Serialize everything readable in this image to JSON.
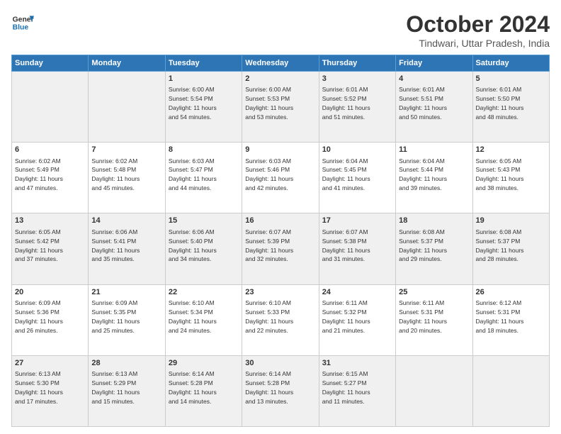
{
  "logo": {
    "line1": "General",
    "line2": "Blue"
  },
  "header": {
    "month": "October 2024",
    "location": "Tindwari, Uttar Pradesh, India"
  },
  "weekdays": [
    "Sunday",
    "Monday",
    "Tuesday",
    "Wednesday",
    "Thursday",
    "Friday",
    "Saturday"
  ],
  "weeks": [
    [
      {
        "day": "",
        "info": ""
      },
      {
        "day": "",
        "info": ""
      },
      {
        "day": "1",
        "info": "Sunrise: 6:00 AM\nSunset: 5:54 PM\nDaylight: 11 hours\nand 54 minutes."
      },
      {
        "day": "2",
        "info": "Sunrise: 6:00 AM\nSunset: 5:53 PM\nDaylight: 11 hours\nand 53 minutes."
      },
      {
        "day": "3",
        "info": "Sunrise: 6:01 AM\nSunset: 5:52 PM\nDaylight: 11 hours\nand 51 minutes."
      },
      {
        "day": "4",
        "info": "Sunrise: 6:01 AM\nSunset: 5:51 PM\nDaylight: 11 hours\nand 50 minutes."
      },
      {
        "day": "5",
        "info": "Sunrise: 6:01 AM\nSunset: 5:50 PM\nDaylight: 11 hours\nand 48 minutes."
      }
    ],
    [
      {
        "day": "6",
        "info": "Sunrise: 6:02 AM\nSunset: 5:49 PM\nDaylight: 11 hours\nand 47 minutes."
      },
      {
        "day": "7",
        "info": "Sunrise: 6:02 AM\nSunset: 5:48 PM\nDaylight: 11 hours\nand 45 minutes."
      },
      {
        "day": "8",
        "info": "Sunrise: 6:03 AM\nSunset: 5:47 PM\nDaylight: 11 hours\nand 44 minutes."
      },
      {
        "day": "9",
        "info": "Sunrise: 6:03 AM\nSunset: 5:46 PM\nDaylight: 11 hours\nand 42 minutes."
      },
      {
        "day": "10",
        "info": "Sunrise: 6:04 AM\nSunset: 5:45 PM\nDaylight: 11 hours\nand 41 minutes."
      },
      {
        "day": "11",
        "info": "Sunrise: 6:04 AM\nSunset: 5:44 PM\nDaylight: 11 hours\nand 39 minutes."
      },
      {
        "day": "12",
        "info": "Sunrise: 6:05 AM\nSunset: 5:43 PM\nDaylight: 11 hours\nand 38 minutes."
      }
    ],
    [
      {
        "day": "13",
        "info": "Sunrise: 6:05 AM\nSunset: 5:42 PM\nDaylight: 11 hours\nand 37 minutes."
      },
      {
        "day": "14",
        "info": "Sunrise: 6:06 AM\nSunset: 5:41 PM\nDaylight: 11 hours\nand 35 minutes."
      },
      {
        "day": "15",
        "info": "Sunrise: 6:06 AM\nSunset: 5:40 PM\nDaylight: 11 hours\nand 34 minutes."
      },
      {
        "day": "16",
        "info": "Sunrise: 6:07 AM\nSunset: 5:39 PM\nDaylight: 11 hours\nand 32 minutes."
      },
      {
        "day": "17",
        "info": "Sunrise: 6:07 AM\nSunset: 5:38 PM\nDaylight: 11 hours\nand 31 minutes."
      },
      {
        "day": "18",
        "info": "Sunrise: 6:08 AM\nSunset: 5:37 PM\nDaylight: 11 hours\nand 29 minutes."
      },
      {
        "day": "19",
        "info": "Sunrise: 6:08 AM\nSunset: 5:37 PM\nDaylight: 11 hours\nand 28 minutes."
      }
    ],
    [
      {
        "day": "20",
        "info": "Sunrise: 6:09 AM\nSunset: 5:36 PM\nDaylight: 11 hours\nand 26 minutes."
      },
      {
        "day": "21",
        "info": "Sunrise: 6:09 AM\nSunset: 5:35 PM\nDaylight: 11 hours\nand 25 minutes."
      },
      {
        "day": "22",
        "info": "Sunrise: 6:10 AM\nSunset: 5:34 PM\nDaylight: 11 hours\nand 24 minutes."
      },
      {
        "day": "23",
        "info": "Sunrise: 6:10 AM\nSunset: 5:33 PM\nDaylight: 11 hours\nand 22 minutes."
      },
      {
        "day": "24",
        "info": "Sunrise: 6:11 AM\nSunset: 5:32 PM\nDaylight: 11 hours\nand 21 minutes."
      },
      {
        "day": "25",
        "info": "Sunrise: 6:11 AM\nSunset: 5:31 PM\nDaylight: 11 hours\nand 20 minutes."
      },
      {
        "day": "26",
        "info": "Sunrise: 6:12 AM\nSunset: 5:31 PM\nDaylight: 11 hours\nand 18 minutes."
      }
    ],
    [
      {
        "day": "27",
        "info": "Sunrise: 6:13 AM\nSunset: 5:30 PM\nDaylight: 11 hours\nand 17 minutes."
      },
      {
        "day": "28",
        "info": "Sunrise: 6:13 AM\nSunset: 5:29 PM\nDaylight: 11 hours\nand 15 minutes."
      },
      {
        "day": "29",
        "info": "Sunrise: 6:14 AM\nSunset: 5:28 PM\nDaylight: 11 hours\nand 14 minutes."
      },
      {
        "day": "30",
        "info": "Sunrise: 6:14 AM\nSunset: 5:28 PM\nDaylight: 11 hours\nand 13 minutes."
      },
      {
        "day": "31",
        "info": "Sunrise: 6:15 AM\nSunset: 5:27 PM\nDaylight: 11 hours\nand 11 minutes."
      },
      {
        "day": "",
        "info": ""
      },
      {
        "day": "",
        "info": ""
      }
    ]
  ]
}
